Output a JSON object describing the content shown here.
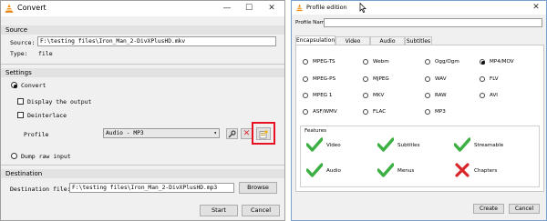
{
  "convert": {
    "title": "Convert",
    "controls": {
      "minimize": "—",
      "maximize": "☐",
      "close": "✕"
    },
    "source_section": "Source",
    "source_label": "Source:",
    "source_value": "F:\\testing files\\Iron_Man_2-DivXPlusHD.mkv",
    "type_label": "Type:",
    "type_value": "file",
    "settings_section": "Settings",
    "convert_option": "Convert",
    "display_output": "Display the output",
    "deinterlace": "Deinterlace",
    "profile_label": "Profile",
    "profile_selected": "Audio - MP3",
    "dump_raw": "Dump raw input",
    "destination_section": "Destination",
    "dest_label": "Destination file:",
    "dest_value": "F:\\testing files\\Iron_Man_2-DivXPlusHD.mp3",
    "browse": "Browse",
    "start": "Start",
    "cancel": "Cancel",
    "highlight_color": "#e81123"
  },
  "profile": {
    "title": "Profile edition",
    "controls": {
      "close": "✕"
    },
    "name_label": "Profile Name",
    "name_value": "",
    "tabs": [
      "Encapsulation",
      "Video codec",
      "Audio codec",
      "Subtitles"
    ],
    "formats": [
      [
        "MPEG-TS",
        "Webm",
        "Ogg/Ogm",
        "MP4/MOV"
      ],
      [
        "MPEG-PS",
        "MJPEG",
        "WAV",
        "FLV"
      ],
      [
        "MPEG 1",
        "MKV",
        "RAW",
        "AVI"
      ],
      [
        "ASF/WMV",
        "FLAC",
        "MP3",
        ""
      ]
    ],
    "selected_format": "MP4/MOV",
    "features_title": "Features",
    "features": [
      {
        "label": "Video",
        "supported": true
      },
      {
        "label": "Subtitles",
        "supported": true
      },
      {
        "label": "Streamable",
        "supported": true
      },
      {
        "label": "Audio",
        "supported": true
      },
      {
        "label": "Menus",
        "supported": true
      },
      {
        "label": "Chapters",
        "supported": false
      }
    ],
    "create": "Create",
    "cancel": "Cancel",
    "check_color": "#3cb043",
    "cross_color": "#d9262b"
  }
}
